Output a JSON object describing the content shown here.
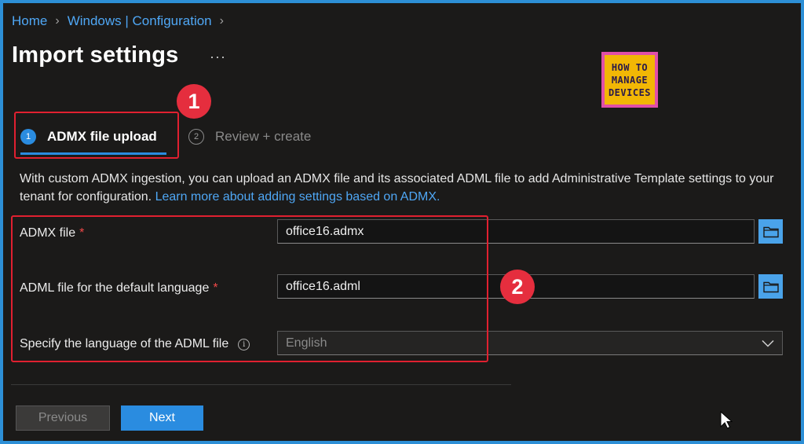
{
  "breadcrumb": {
    "items": [
      "Home",
      "Windows | Configuration"
    ]
  },
  "page": {
    "title": "Import settings",
    "more": "···"
  },
  "logo": {
    "lines": [
      "HOW TO",
      "MANAGE",
      "DEVICES"
    ]
  },
  "annotations": {
    "badge1": "1",
    "badge2": "2"
  },
  "steps": [
    {
      "number": "1",
      "label": "ADMX file upload"
    },
    {
      "number": "2",
      "label": "Review + create"
    }
  ],
  "description": {
    "text": "With custom ADMX ingestion, you can upload an ADMX file and its associated ADML file to add Administrative Template settings to your tenant for configuration.",
    "link": "Learn more about adding settings based on ADMX."
  },
  "form": {
    "admx_label": "ADMX file",
    "admx_value": "office16.admx",
    "adml_label": "ADML file for the default language",
    "adml_value": "office16.adml",
    "required_mark": "*",
    "language_label": "Specify the language of the ADML file",
    "language_value": "English",
    "info_glyph": "i"
  },
  "footer": {
    "previous": "Previous",
    "next": "Next"
  },
  "colors": {
    "accent": "#2a8ce0",
    "link": "#4fa7f5",
    "highlight": "#e02030",
    "badge": "#e52e3e"
  }
}
